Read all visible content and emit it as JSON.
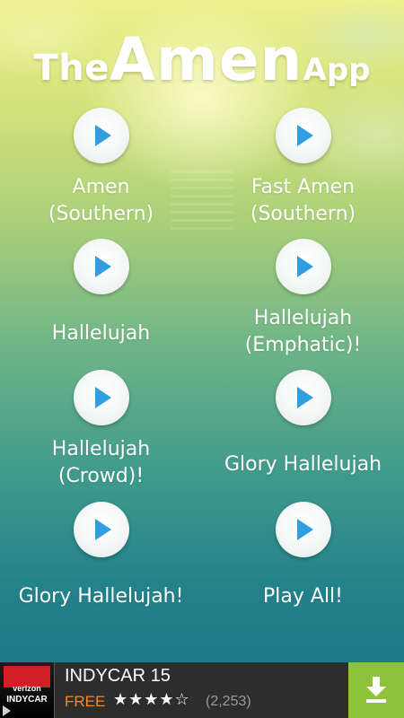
{
  "app": {
    "title_the": "The",
    "title_amen": "Amen",
    "title_app": "App"
  },
  "buttons": [
    {
      "lines": [
        "Amen",
        "(Southern)"
      ]
    },
    {
      "lines": [
        "Fast Amen",
        "(Southern)"
      ]
    },
    {
      "lines": [
        "Hallelujah"
      ]
    },
    {
      "lines": [
        "Hallelujah",
        "(Emphatic)!"
      ]
    },
    {
      "lines": [
        "Hallelujah",
        "(Crowd)!"
      ]
    },
    {
      "lines": [
        "Glory Hallelujah"
      ]
    },
    {
      "lines": [
        "Glory Hallelujah!"
      ]
    },
    {
      "lines": [
        "Play All!"
      ]
    }
  ],
  "icons": {
    "play": "play-triangle",
    "download": "download-arrow"
  },
  "ad": {
    "logo_brand": "verizon",
    "logo_series": "INDYCAR",
    "title": "INDYCAR 15",
    "price": "FREE",
    "stars": "★★★★☆",
    "rating_value": 4,
    "rating_max": 5,
    "review_count": "(2,253)"
  },
  "colors": {
    "play_triangle": "#2e9fe0",
    "ad_background": "#2d2d2d",
    "ad_button": "#8fc23b",
    "ad_price": "#f08b2a"
  }
}
